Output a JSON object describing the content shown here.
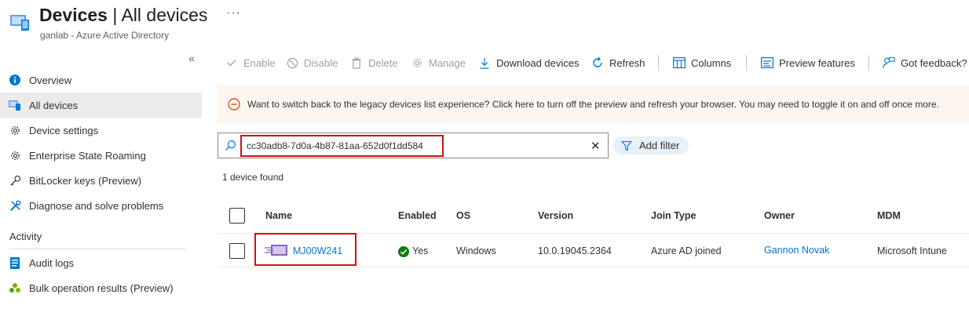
{
  "header": {
    "title_bold": "Devices",
    "title_rest": " | All devices",
    "subtitle": "ganlab - Azure Active Directory",
    "more": "···",
    "collapse": "«"
  },
  "sidebar": {
    "items": [
      {
        "label": "Overview",
        "icon": "info-icon"
      },
      {
        "label": "All devices",
        "icon": "devices-icon",
        "active": true
      },
      {
        "label": "Device settings",
        "icon": "gear-icon"
      },
      {
        "label": "Enterprise State Roaming",
        "icon": "gear-icon"
      },
      {
        "label": "BitLocker keys (Preview)",
        "icon": "key-icon"
      },
      {
        "label": "Diagnose and solve problems",
        "icon": "wrench-icon"
      }
    ],
    "section_title": "Activity",
    "activity_items": [
      {
        "label": "Audit logs",
        "icon": "audit-log-icon"
      },
      {
        "label": "Bulk operation results (Preview)",
        "icon": "people-icon"
      }
    ]
  },
  "toolbar": {
    "enable": "Enable",
    "disable": "Disable",
    "delete": "Delete",
    "manage": "Manage",
    "download": "Download devices",
    "refresh": "Refresh",
    "columns": "Columns",
    "preview": "Preview features",
    "feedback": "Got feedback?"
  },
  "banner": {
    "text": "Want to switch back to the legacy devices list experience? Click here to turn off the preview and refresh your browser. You may need to toggle it on and off once more."
  },
  "search": {
    "value": "cc30adb8-7d0a-4b87-81aa-652d0f1dd584",
    "clear": "✕",
    "add_filter": "Add filter"
  },
  "results": {
    "count_text": "1 device found"
  },
  "table": {
    "headers": {
      "name": "Name",
      "enabled": "Enabled",
      "os": "OS",
      "version": "Version",
      "join_type": "Join Type",
      "owner": "Owner",
      "mdm": "MDM"
    },
    "rows": [
      {
        "name": "MJ00W241",
        "enabled": "Yes",
        "os": "Windows",
        "version": "10.0.19045.2364",
        "join_type": "Azure AD joined",
        "owner": "Gannon Novak",
        "mdm": "Microsoft Intune"
      }
    ]
  },
  "colors": {
    "accent": "#0078d4",
    "highlight": "#d01010",
    "banner_bg": "#fdf6f0",
    "banner_icon": "#d83b01",
    "success": "#107c10",
    "active_item_bg": "#edebe9",
    "device_icon": "#8764b8"
  }
}
